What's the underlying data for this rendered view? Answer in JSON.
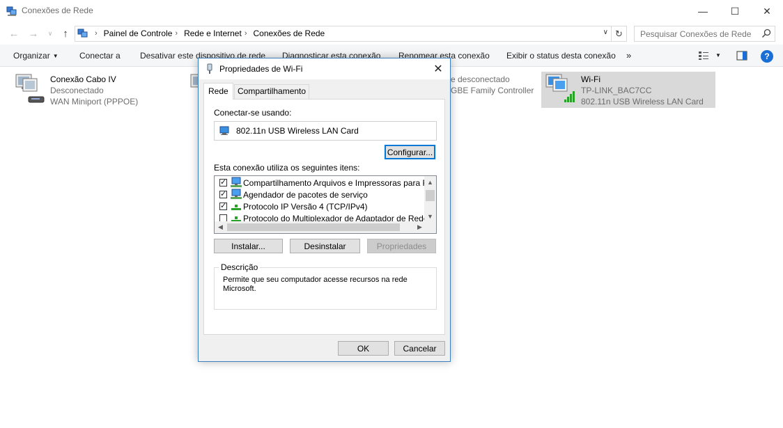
{
  "window": {
    "title": "Conexões de Rede",
    "minimize": "—",
    "maximize": "☐",
    "close": "✕"
  },
  "nav": {
    "back": "←",
    "forward": "→",
    "history": "∨",
    "up": "↑"
  },
  "breadcrumbs": [
    "Painel de Controle",
    "Rede e Internet",
    "Conexões de Rede"
  ],
  "breadcrumb_sep": "›",
  "search": {
    "placeholder": "Pesquisar Conexões de Rede"
  },
  "commands": [
    "Organizar",
    "Conectar a",
    "Desativar este dispositivo de rede",
    "Diagnosticar esta conexão",
    "Renomear esta conexão",
    "Exibir o status desta conexão",
    "»"
  ],
  "connections": [
    {
      "name": "Conexão Cabo IV",
      "status": "Desconectado",
      "device": "WAN Miniport (PPPOE)"
    },
    {
      "name": "",
      "status": "e desconectado",
      "device": "GBE Family Controller"
    },
    {
      "name": "Wi-Fi",
      "status": "TP-LINK_BAC7CC",
      "device": "802.11n USB Wireless LAN Card"
    }
  ],
  "dialog": {
    "title": "Propriedades de Wi-Fi",
    "tabs": [
      "Rede",
      "Compartilhamento"
    ],
    "connect_using_label": "Conectar-se usando:",
    "adapter_name": "802.11n USB Wireless LAN Card",
    "configure_button": "Configurar...",
    "items_label": "Esta conexão utiliza os seguintes itens:",
    "items": [
      {
        "label": "Compartilhamento Arquivos e Impressoras para Redes Microsoft",
        "checked": true,
        "icon": "network-service-icon"
      },
      {
        "label": "Agendador de pacotes de serviço",
        "checked": true,
        "icon": "network-service-icon"
      },
      {
        "label": "Protocolo IP Versão 4 (TCP/IPv4)",
        "checked": true,
        "icon": "protocol-icon"
      },
      {
        "label": "Protocolo do Multiplexador de Adaptador de Rede da Microsoft",
        "checked": false,
        "icon": "protocol-icon"
      }
    ],
    "install_button": "Instalar...",
    "uninstall_button": "Desinstalar",
    "properties_button": "Propriedades",
    "description_label": "Descrição",
    "description_text": "Permite que seu computador acesse recursos na rede Microsoft.",
    "ok_button": "OK",
    "cancel_button": "Cancelar"
  },
  "colors": {
    "accent": "#0078d7",
    "selection": "#d9d9d9",
    "help": "#1a6fd6"
  }
}
